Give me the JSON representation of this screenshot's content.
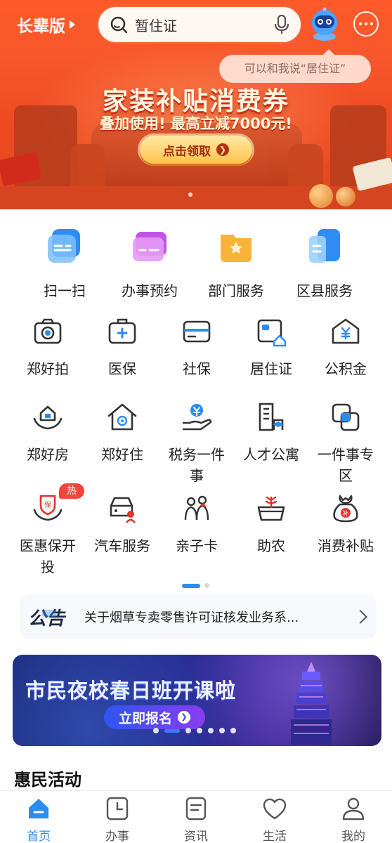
{
  "header": {
    "elder_mode_label": "长辈版",
    "search_value": "暂住证",
    "assistant_tip": "可以和我说“居住证”"
  },
  "banner": {
    "headline": "家装补贴消费券",
    "subline": "叠加使用! 最高立减7000元!",
    "cta_label": "点击领取"
  },
  "quick_services": [
    {
      "label": "扫一扫",
      "icon": "scan-icon"
    },
    {
      "label": "办事预约",
      "icon": "appointment-icon"
    },
    {
      "label": "部门服务",
      "icon": "department-icon"
    },
    {
      "label": "区县服务",
      "icon": "district-icon"
    }
  ],
  "services_row1": [
    {
      "label": "郑好拍",
      "icon": "camera-icon"
    },
    {
      "label": "医保",
      "icon": "medical-kit-icon"
    },
    {
      "label": "社保",
      "icon": "card-icon"
    },
    {
      "label": "居住证",
      "icon": "residence-card-icon"
    },
    {
      "label": "公积金",
      "icon": "housing-fund-icon"
    }
  ],
  "services_row2": [
    {
      "label": "郑好房",
      "icon": "house-hands-icon"
    },
    {
      "label": "郑好住",
      "icon": "home-icon"
    },
    {
      "label": "税务一件事",
      "line1": "税务一件",
      "line2": "事",
      "icon": "tax-icon"
    },
    {
      "label": "人才公寓",
      "icon": "apartment-icon"
    },
    {
      "label": "一件事专区",
      "line1": "一件事专",
      "line2": "区",
      "icon": "overlap-squares-icon"
    }
  ],
  "services_row3": [
    {
      "label": "医惠保开投",
      "line1": "医惠保开",
      "line2": "投",
      "icon": "insurance-shield-icon",
      "badge": "热"
    },
    {
      "label": "汽车服务",
      "icon": "car-icon"
    },
    {
      "label": "亲子卡",
      "icon": "family-icon"
    },
    {
      "label": "助农",
      "icon": "basket-icon"
    },
    {
      "label": "消费补贴",
      "icon": "money-bag-icon"
    }
  ],
  "notice": {
    "badge": "公告",
    "text": "关于烟草专卖零售许可证核发业务系..."
  },
  "promo": {
    "title": "市民夜校春日班开课啦",
    "button": "立即报名"
  },
  "section_title": "惠民活动",
  "tabbar": [
    {
      "label": "首页",
      "icon": "home-tab-icon",
      "active": true
    },
    {
      "label": "办事",
      "icon": "clock-doc-icon",
      "active": false
    },
    {
      "label": "资讯",
      "icon": "news-icon",
      "active": false
    },
    {
      "label": "生活",
      "icon": "heart-icon",
      "active": false
    },
    {
      "label": "我的",
      "icon": "user-icon",
      "active": false
    }
  ],
  "colors": {
    "accent": "#2b8cf2",
    "banner": "#f7572c",
    "hot": "#f2463a"
  }
}
